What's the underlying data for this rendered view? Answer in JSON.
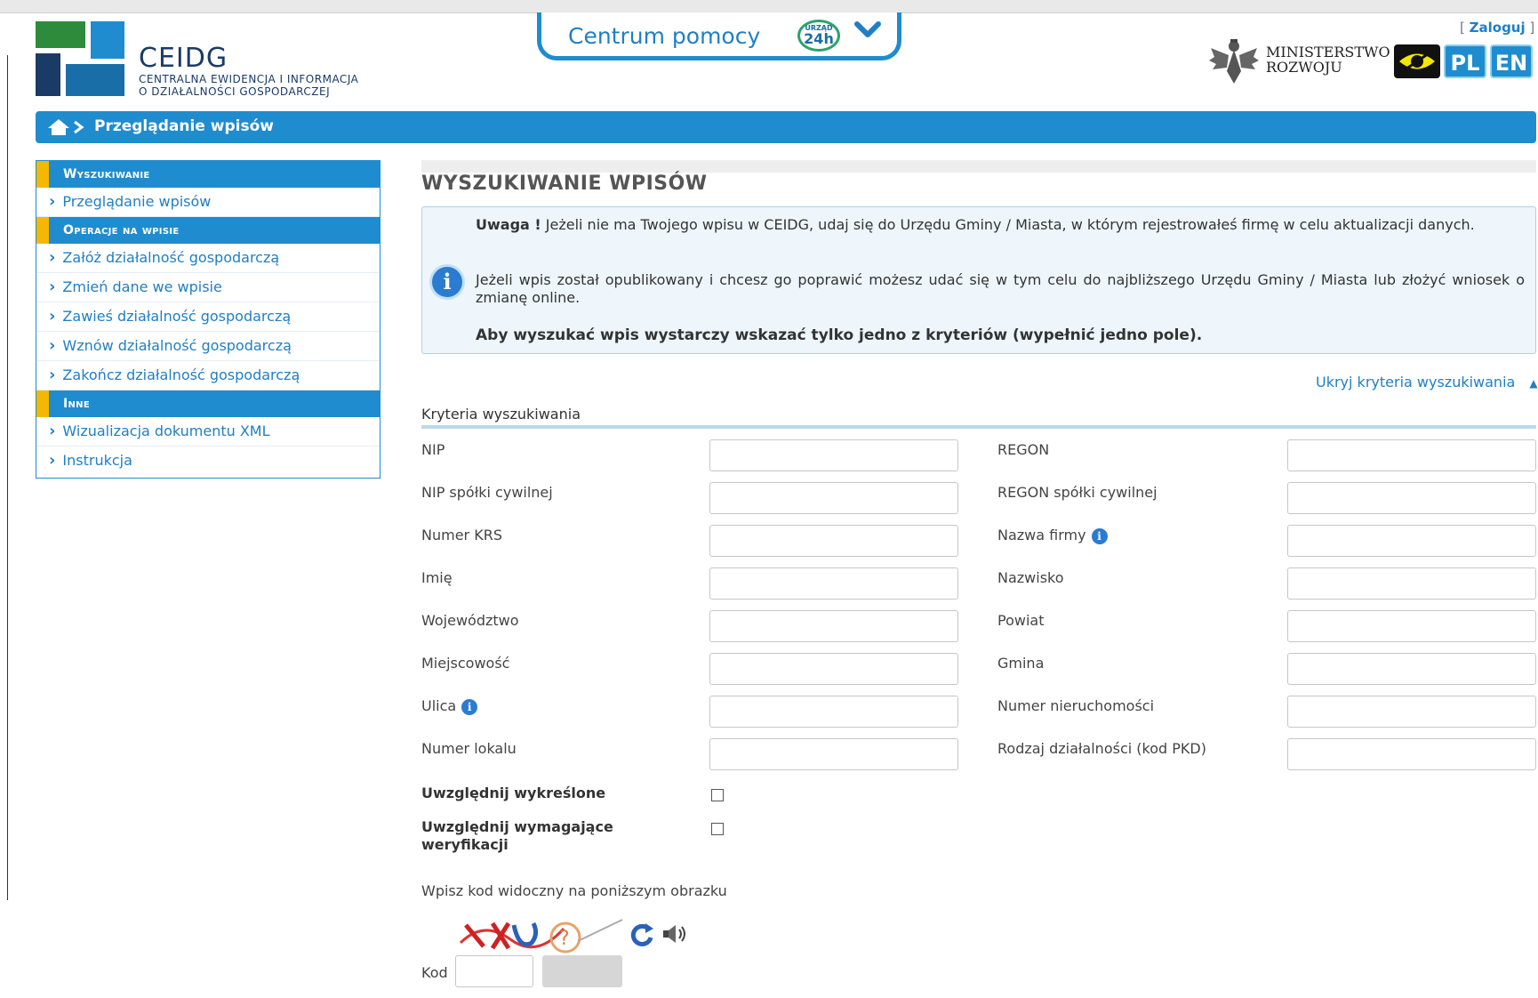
{
  "header": {
    "brand": "CEIDG",
    "brand_sub_1": "CENTRALNA EWIDENCJA I INFORMACJA",
    "brand_sub_2": "O DZIAŁALNOŚCI GOSPODARCZEJ",
    "help_label": "Centrum pomocy",
    "help_badge_top": "URZĄD",
    "help_badge_main": "24h",
    "login_label": "Zaloguj",
    "ministry_1": "MINISTERSTWO",
    "ministry_2": "ROZWOJU",
    "lang_pl": "PL",
    "lang_en": "EN"
  },
  "breadcrumb": {
    "current": "Przeglądanie wpisów"
  },
  "sidebar": {
    "sections": [
      {
        "title": "Wyszukiwanie",
        "items": [
          "Przeglądanie wpisów"
        ]
      },
      {
        "title": "Operacje na wpisie",
        "items": [
          "Załóż działalność gospodarczą",
          "Zmień dane we wpisie",
          "Zawieś działalność gospodarczą",
          "Wznów działalność gospodarczą",
          "Zakończ działalność gospodarczą"
        ]
      },
      {
        "title": "Inne",
        "items": [
          "Wizualizacja dokumentu XML",
          "Instrukcja"
        ]
      }
    ]
  },
  "main": {
    "title": "WYSZUKIWANIE WPISÓW",
    "info": {
      "warn_bold": "Uwaga !",
      "warn_text": " Jeżeli nie ma Twojego wpisu w CEIDG, udaj się do Urzędu Gminy / Miasta, w którym rejestrowałeś firmę w celu aktualizacji danych.",
      "para2": "Jeżeli wpis został opublikowany i chcesz go poprawić możesz udać się w tym celu do najbliższego Urzędu Gminy / Miasta lub złożyć wniosek o zmianę online.",
      "para3": "Aby wyszukać wpis wystarczy wskazać tylko jedno z kryteriów (wypełnić jedno pole)."
    },
    "hide_criteria": "Ukryj kryteria wyszukiwania",
    "criteria_title": "Kryteria wyszukiwania",
    "fields_left": [
      "NIP",
      "NIP spółki cywilnej",
      "Numer KRS",
      "Imię",
      "Województwo",
      "Miejscowość",
      "Ulica",
      "Numer lokalu"
    ],
    "fields_right": [
      "REGON",
      "REGON spółki cywilnej",
      "Nazwa firmy",
      "Nazwisko",
      "Powiat",
      "Gmina",
      "Numer nieruchomości",
      "Rodzaj działalności (kod PKD)"
    ],
    "checkbox_1": "Uwzględnij wykreślone",
    "checkbox_2a": "Uwzględnij wymagające",
    "checkbox_2b": "weryfikacji",
    "captcha_label": "Wpisz kod widoczny na poniższym obrazku",
    "code_label": "Kod"
  }
}
